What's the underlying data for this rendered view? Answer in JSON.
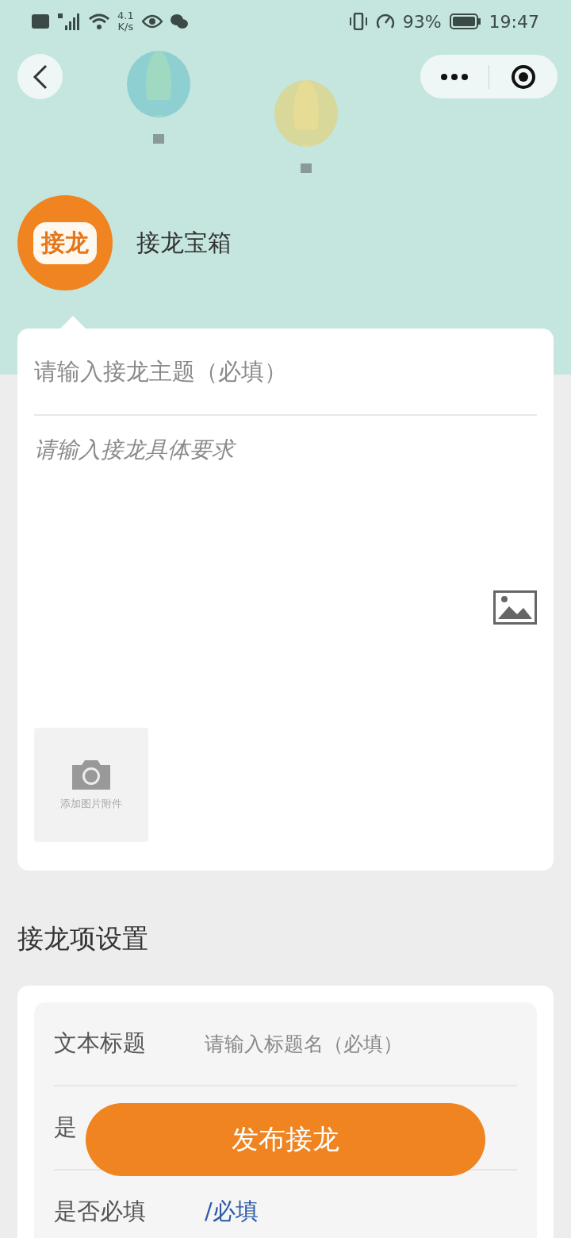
{
  "status_bar": {
    "speed_value": "4.1",
    "speed_unit": "K/s",
    "battery": "93%",
    "time": "19:47"
  },
  "app": {
    "logo_text": "接龙",
    "name": "接龙宝箱"
  },
  "form": {
    "title_placeholder": "请输入接龙主题（必填）",
    "description_placeholder": "请输入接龙具体要求",
    "attachment_label": "添加图片附件"
  },
  "section_title": "接龙项设置",
  "item_rows": [
    {
      "kind": "input",
      "label": "文本标题",
      "placeholder": "请输入标题名（必填）"
    },
    {
      "kind": "covered",
      "label": "是"
    },
    {
      "kind": "value",
      "label": "是否必填",
      "value": "/必填"
    }
  ],
  "publish_button": "发布接龙"
}
